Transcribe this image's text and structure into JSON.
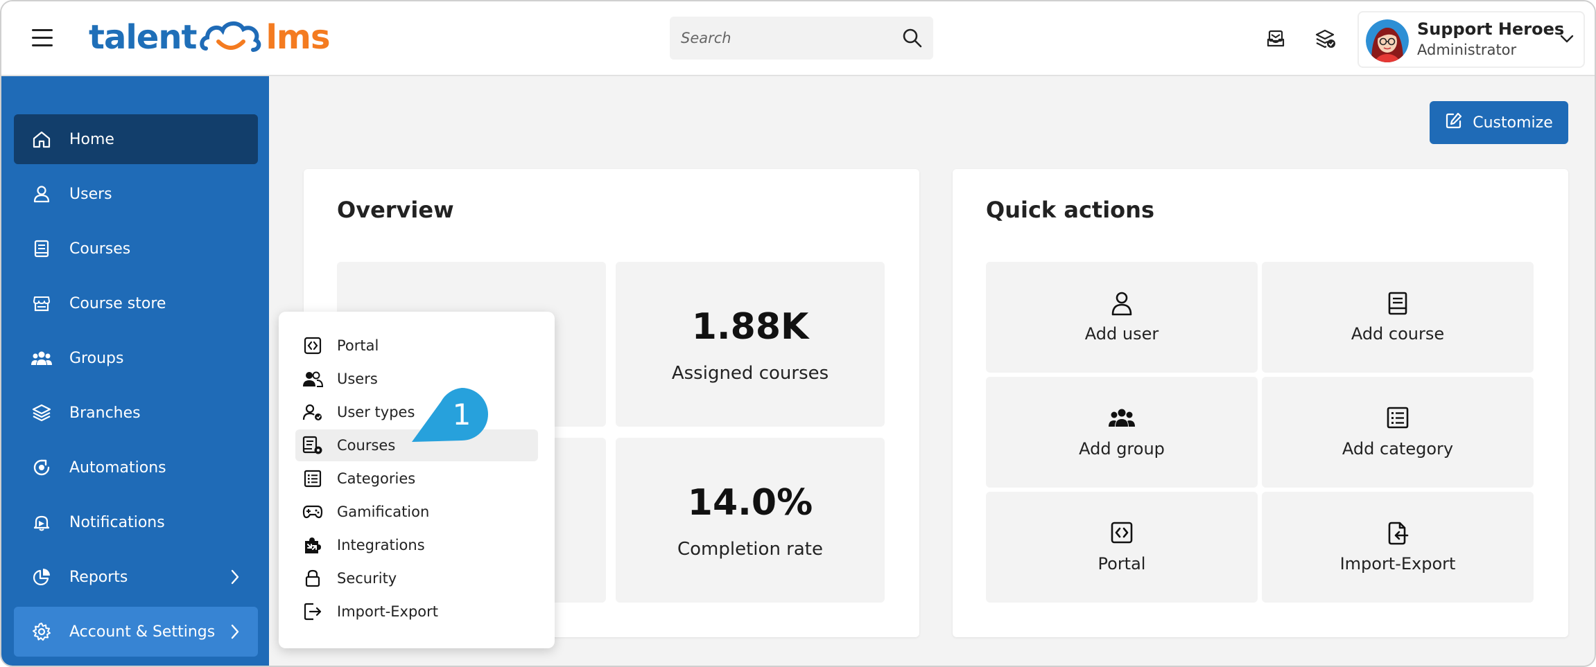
{
  "header": {
    "logo": {
      "part1": "talent",
      "part2": "lms"
    },
    "search": {
      "placeholder": "Search",
      "value": ""
    },
    "user": {
      "name": "Support Heroes",
      "role": "Administrator"
    }
  },
  "sidebar": {
    "items": [
      {
        "label": "Home",
        "icon": "home-icon",
        "state": "active"
      },
      {
        "label": "Users",
        "icon": "user-icon"
      },
      {
        "label": "Courses",
        "icon": "book-icon"
      },
      {
        "label": "Course store",
        "icon": "store-icon"
      },
      {
        "label": "Groups",
        "icon": "groups-icon"
      },
      {
        "label": "Branches",
        "icon": "layers-icon"
      },
      {
        "label": "Automations",
        "icon": "automation-icon"
      },
      {
        "label": "Notifications",
        "icon": "bell-icon"
      },
      {
        "label": "Reports",
        "icon": "pie-chart-icon",
        "has_submenu": true
      },
      {
        "label": "Account & Settings",
        "icon": "gear-icon",
        "has_submenu": true,
        "state": "selected"
      }
    ]
  },
  "main": {
    "customize_label": "Customize",
    "overview": {
      "title": "Overview",
      "stats": [
        {
          "value": "1.88K",
          "label": "Assigned courses"
        },
        {
          "value": "14.0%",
          "label": "Completion rate"
        }
      ]
    },
    "quick_actions": {
      "title": "Quick actions",
      "items": [
        {
          "label": "Add user",
          "icon": "user-icon"
        },
        {
          "label": "Add course",
          "icon": "book-icon"
        },
        {
          "label": "Add group",
          "icon": "groups-icon"
        },
        {
          "label": "Add category",
          "icon": "list-icon"
        },
        {
          "label": "Portal",
          "icon": "code-icon"
        },
        {
          "label": "Import-Export",
          "icon": "import-export-icon"
        }
      ]
    }
  },
  "dropdown": {
    "items": [
      {
        "label": "Portal",
        "icon": "code-icon"
      },
      {
        "label": "Users",
        "icon": "users-icon"
      },
      {
        "label": "User types",
        "icon": "user-types-icon"
      },
      {
        "label": "Courses",
        "icon": "courses-settings-icon",
        "state": "hover"
      },
      {
        "label": "Categories",
        "icon": "list-icon"
      },
      {
        "label": "Gamification",
        "icon": "gamepad-icon"
      },
      {
        "label": "Integrations",
        "icon": "puzzle-icon"
      },
      {
        "label": "Security",
        "icon": "lock-icon"
      },
      {
        "label": "Import-Export",
        "icon": "import-export-icon"
      }
    ]
  },
  "callout": {
    "number": "1"
  },
  "colors": {
    "brand_blue": "#1f6bb7",
    "brand_orange": "#f47b20",
    "sidebar_active": "#123e6b",
    "sidebar_selected": "#3784d3",
    "callout_blue": "#27a1dc"
  }
}
